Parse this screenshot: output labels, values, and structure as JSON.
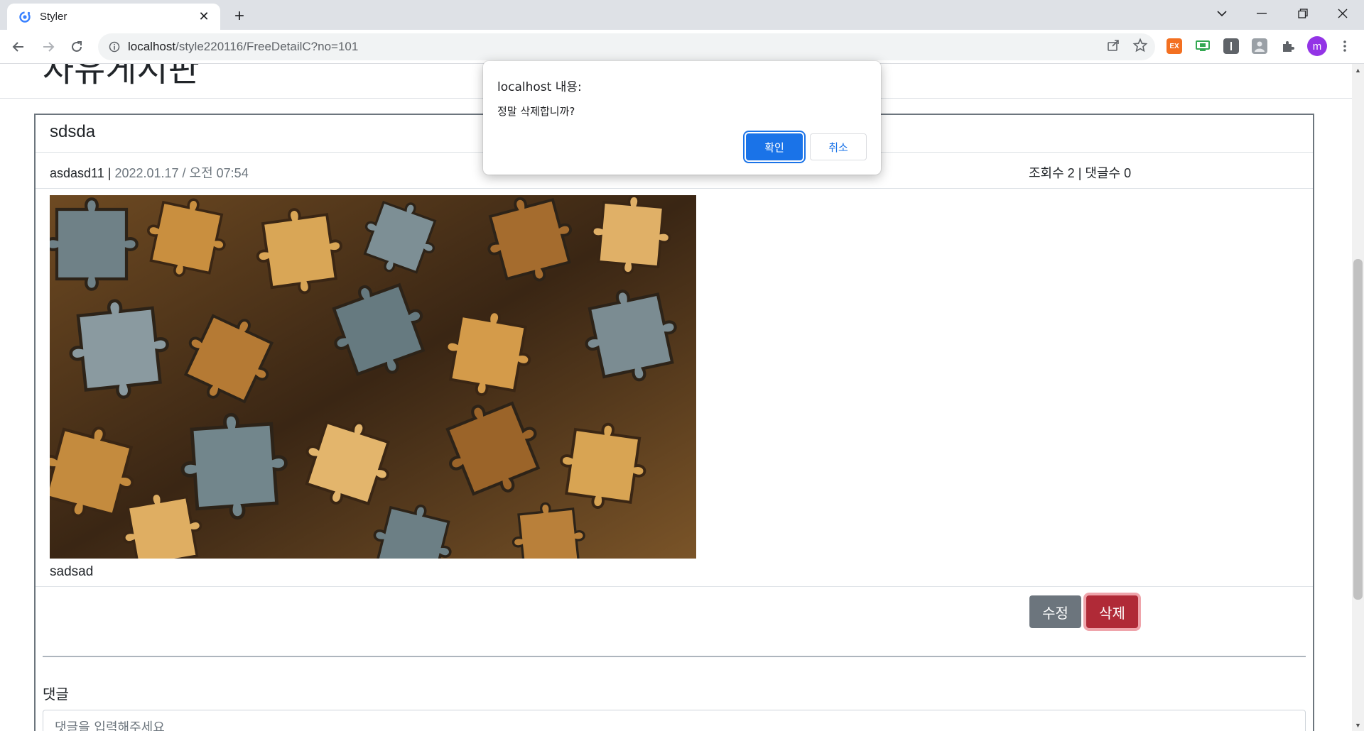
{
  "browser": {
    "tab_title": "Styler",
    "url_host": "localhost",
    "url_path": "/style220116/FreeDetailC?no=101",
    "ext_label": "EX",
    "profile_initial": "m"
  },
  "page": {
    "heading": "자유게시판",
    "post": {
      "title": "sdsda",
      "author": "asdasd11",
      "separator": "|",
      "date": "2022.01.17 / 오전 07:54",
      "views_label": "조회수 2",
      "comments_label": "댓글수 0",
      "body": "sadsad",
      "image_alt": "jigsaw puzzle pieces"
    },
    "buttons": {
      "edit": "수정",
      "delete": "삭제"
    },
    "comment": {
      "label": "댓글",
      "placeholder": "댓글을 입력해주세요"
    }
  },
  "dialog": {
    "title": "localhost 내용:",
    "message": "정말 삭제합니까?",
    "ok": "확인",
    "cancel": "취소"
  },
  "colors": {
    "accent": "#1a73e8",
    "danger": "#b02a37",
    "secondary": "#6c757d"
  }
}
